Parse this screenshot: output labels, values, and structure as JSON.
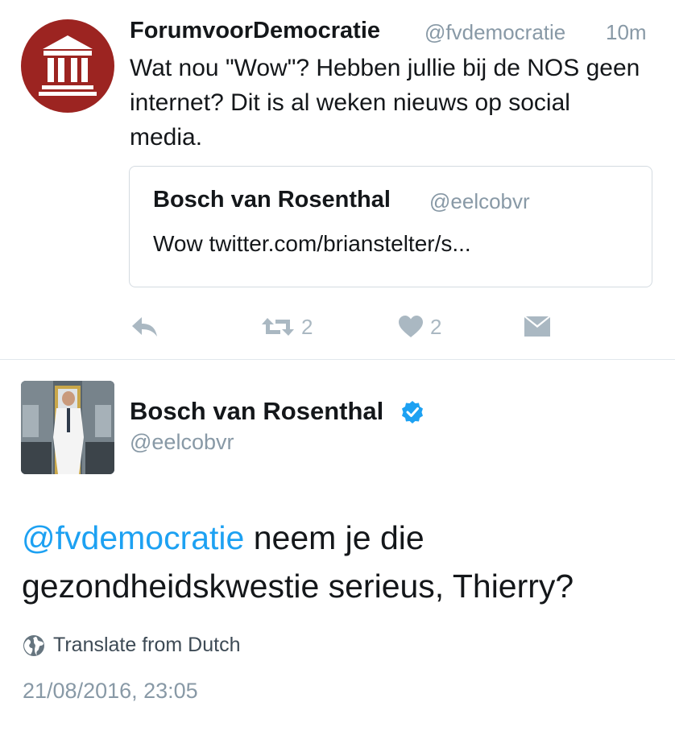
{
  "tweet1": {
    "author_name": "ForumvoorDemocratie",
    "handle": "@fvdemocratie",
    "time": "10m",
    "text": "Wat nou \"Wow\"?  Hebben jullie bij de NOS geen internet? Dit is al weken nieuws op social media.",
    "avatar_icon": "building-logo-icon",
    "avatar_color": "#9c2421",
    "quoted": {
      "author_name": "Bosch van Rosenthal",
      "handle": "@eelcobvr",
      "text": "Wow twitter.com/brianstelter/s..."
    },
    "actions": {
      "reply_icon": "reply-icon",
      "retweet_icon": "retweet-icon",
      "retweet_count": "2",
      "like_icon": "heart-icon",
      "like_count": "2",
      "dm_icon": "envelope-icon"
    }
  },
  "tweet2": {
    "author_name": "Bosch van Rosenthal",
    "verified_icon": "verified-badge-icon",
    "handle": "@eelcobvr",
    "mention": "@fvdemocratie",
    "text_rest": " neem je die gezondheidskwestie serieus, Thierry?",
    "translate_icon": "globe-icon",
    "translate_label": "Translate from Dutch",
    "timestamp": "21/08/2016, 23:05"
  },
  "colors": {
    "accent": "#1da1f2",
    "muted": "#8899a6",
    "icon_gray": "#aab8c2",
    "divider": "#e1e8ed"
  }
}
